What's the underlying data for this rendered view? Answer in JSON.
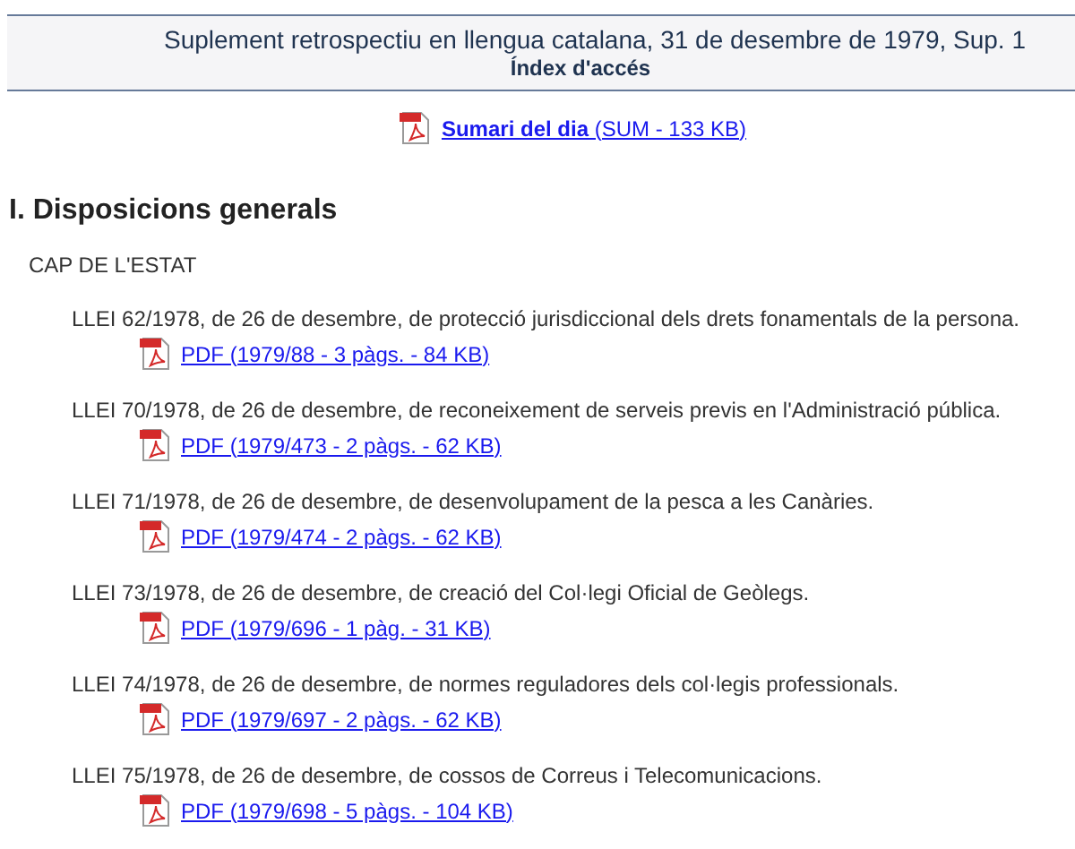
{
  "header": {
    "title": "Suplement retrospectiu en llengua catalana, 31 de desembre de 1979, Sup. 1",
    "subtitle": "Índex d'accés"
  },
  "summary_link": "**Sumari del dia** (SUM - 133 KB)",
  "section": {
    "heading": "I. Disposicions generals",
    "group": "CAP DE L'ESTAT",
    "items": [
      {
        "title": "LLEI 62/1978, de 26 de desembre, de protecció jurisdiccional dels drets fonamentals de la persona.",
        "link": "PDF (1979/88 - 3 pàgs. - 84 KB)"
      },
      {
        "title": "LLEI 70/1978, de 26 de desembre, de reconeixement de serveis previs en l'Administració pública.",
        "link": "PDF (1979/473 - 2 pàgs. - 62 KB)"
      },
      {
        "title": "LLEI 71/1978, de 26 de desembre, de desenvolupament de la pesca a les Canàries.",
        "link": "PDF (1979/474 - 2 pàgs. - 62 KB)"
      },
      {
        "title": "LLEI 73/1978, de 26 de desembre, de creació del Col·legi Oficial de Geòlegs.",
        "link": "PDF (1979/696 - 1 pàg. - 31 KB)"
      },
      {
        "title": "LLEI 74/1978, de 26 de desembre, de normes reguladores dels col·legis professionals.",
        "link": "PDF (1979/697 - 2 pàgs. - 62 KB)"
      },
      {
        "title": "LLEI 75/1978, de 26 de desembre, de cossos de Correus i Telecomunicacions.",
        "link": "PDF (1979/698 - 5 pàgs. - 104 KB)"
      }
    ]
  }
}
